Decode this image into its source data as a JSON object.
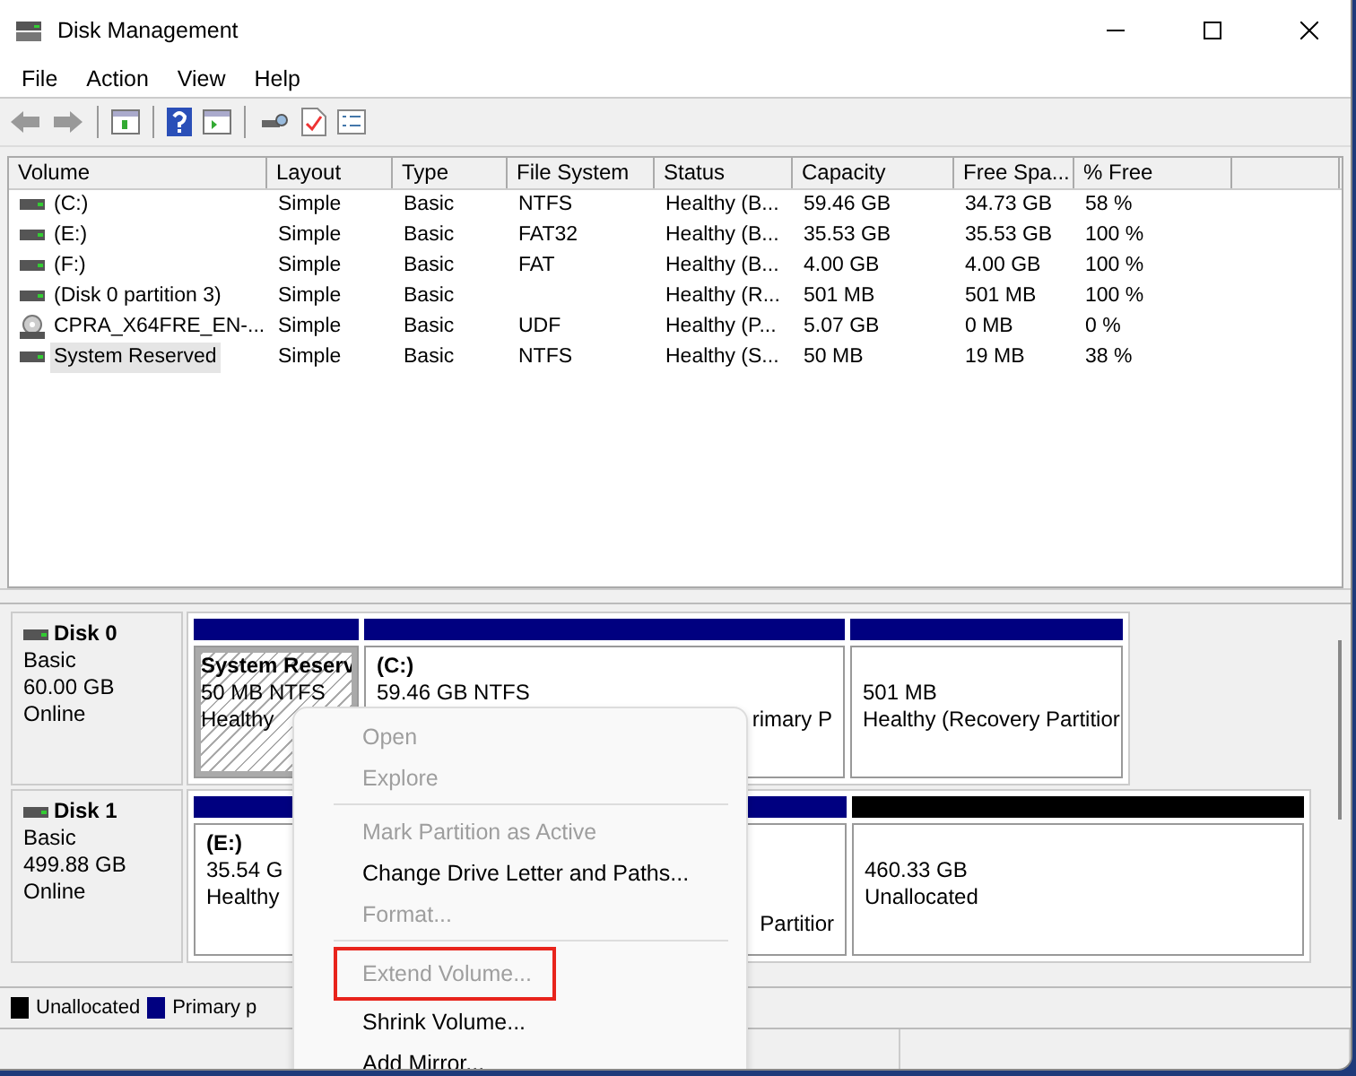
{
  "window": {
    "title": "Disk Management"
  },
  "menu_bar": [
    "File",
    "Action",
    "View",
    "Help"
  ],
  "table": {
    "columns": [
      "Volume",
      "Layout",
      "Type",
      "File System",
      "Status",
      "Capacity",
      "Free Spa...",
      "% Free"
    ],
    "rows": [
      {
        "kind": "disk",
        "selected": false,
        "cells": [
          "(C:)",
          "Simple",
          "Basic",
          "NTFS",
          "Healthy (B...",
          "59.46 GB",
          "34.73 GB",
          "58 %"
        ]
      },
      {
        "kind": "disk",
        "selected": false,
        "cells": [
          "(E:)",
          "Simple",
          "Basic",
          "FAT32",
          "Healthy (B...",
          "35.53 GB",
          "35.53 GB",
          "100 %"
        ]
      },
      {
        "kind": "disk",
        "selected": false,
        "cells": [
          "(F:)",
          "Simple",
          "Basic",
          "FAT",
          "Healthy (B...",
          "4.00 GB",
          "4.00 GB",
          "100 %"
        ]
      },
      {
        "kind": "disk",
        "selected": false,
        "cells": [
          "(Disk 0 partition 3)",
          "Simple",
          "Basic",
          "",
          "Healthy (R...",
          "501 MB",
          "501 MB",
          "100 %"
        ]
      },
      {
        "kind": "cd",
        "selected": false,
        "cells": [
          "CPRA_X64FRE_EN-...",
          "Simple",
          "Basic",
          "UDF",
          "Healthy (P...",
          "5.07 GB",
          "0 MB",
          "0 %"
        ]
      },
      {
        "kind": "disk",
        "selected": true,
        "cells": [
          "System Reserved",
          "Simple",
          "Basic",
          "NTFS",
          "Healthy (S...",
          "50 MB",
          "19 MB",
          "38 %"
        ]
      }
    ]
  },
  "disks": [
    {
      "name": "Disk 0",
      "type": "Basic",
      "size": "60.00 GB",
      "status": "Online",
      "partitions": [
        {
          "kind": "primary",
          "selected": true,
          "title": "System Reserv",
          "size": "50 MB NTFS",
          "status": "Healthy"
        },
        {
          "kind": "primary",
          "selected": false,
          "title": "(C:)",
          "size": "59.46 GB NTFS",
          "status": "rimary P"
        },
        {
          "kind": "primary",
          "selected": false,
          "size": "501 MB",
          "status": "Healthy (Recovery Partitior"
        }
      ]
    },
    {
      "name": "Disk 1",
      "type": "Basic",
      "size": "499.88 GB",
      "status": "Online",
      "partitions": [
        {
          "kind": "primary",
          "selected": false,
          "title": "(E:)",
          "size": "35.54 G",
          "status": "Healthy",
          "status_right": "Partitior"
        },
        {
          "kind": "unallocated",
          "selected": false,
          "size": "460.33 GB",
          "status": "Unallocated"
        }
      ]
    }
  ],
  "legend": [
    {
      "kind": "unallocated",
      "label": "Unallocated"
    },
    {
      "kind": "primary",
      "label": "Primary p"
    }
  ],
  "context_menu": [
    {
      "kind": "item",
      "label": "Open",
      "disabled": true,
      "highlighted": false
    },
    {
      "kind": "item",
      "label": "Explore",
      "disabled": true,
      "highlighted": false
    },
    {
      "kind": "separator"
    },
    {
      "kind": "item",
      "label": "Mark Partition as Active",
      "disabled": true,
      "highlighted": false
    },
    {
      "kind": "item",
      "label": "Change Drive Letter and Paths...",
      "disabled": false,
      "highlighted": false
    },
    {
      "kind": "item",
      "label": "Format...",
      "disabled": true,
      "highlighted": false
    },
    {
      "kind": "separator"
    },
    {
      "kind": "item",
      "label": "Extend Volume...",
      "disabled": true,
      "highlighted": true
    },
    {
      "kind": "item",
      "label": "Shrink Volume...",
      "disabled": false,
      "highlighted": false
    },
    {
      "kind": "item",
      "label": "Add Mirror...",
      "disabled": false,
      "highlighted": false
    }
  ]
}
